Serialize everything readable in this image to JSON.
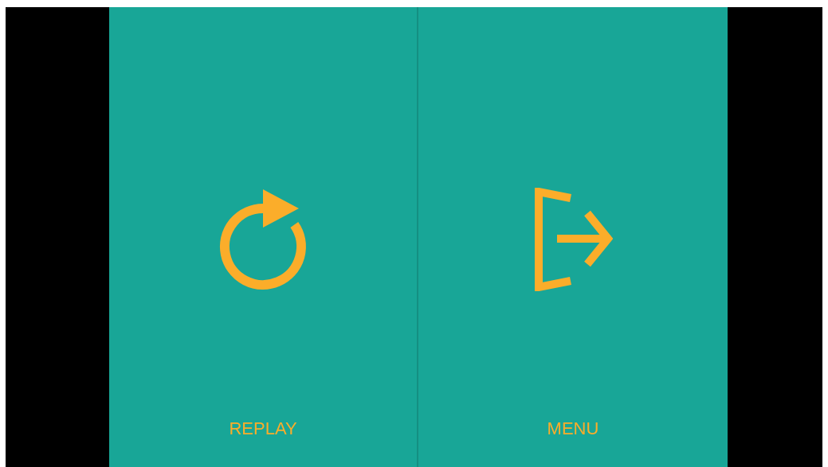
{
  "buttons": [
    {
      "label": "REPLAY",
      "kind": "replay"
    },
    {
      "label": "MENU",
      "kind": "exit"
    }
  ]
}
